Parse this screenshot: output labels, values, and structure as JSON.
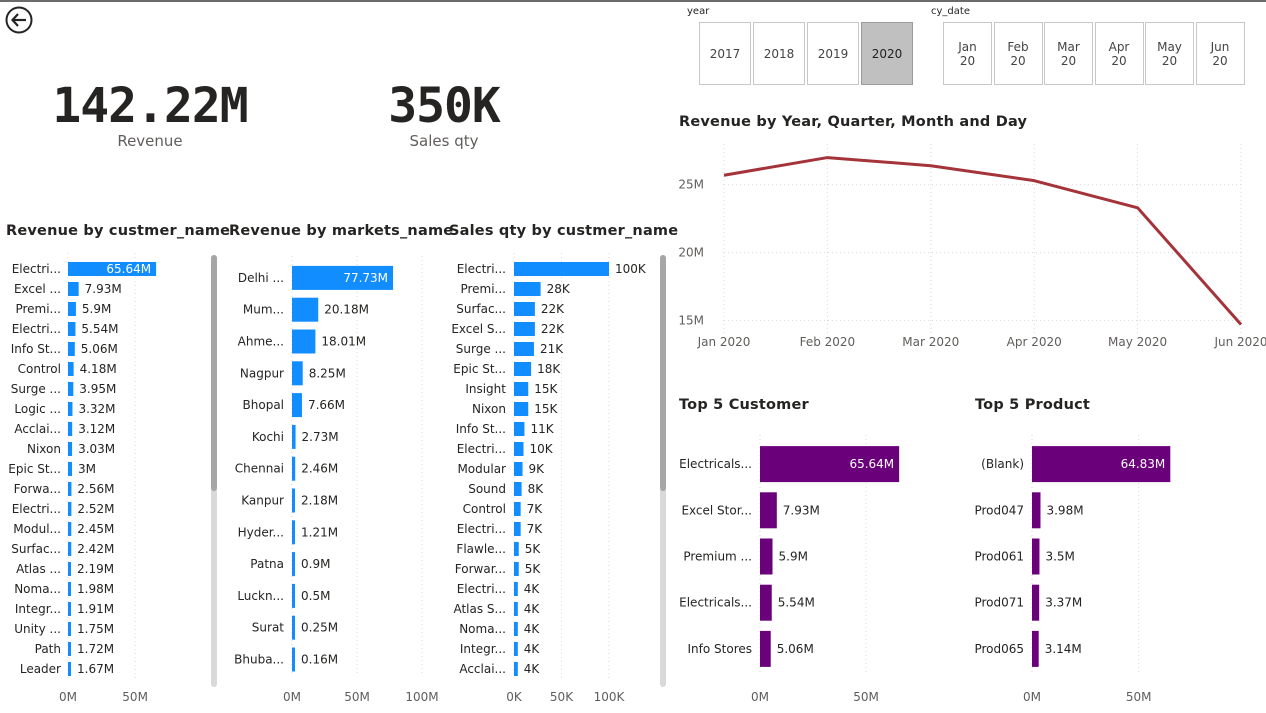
{
  "kpis": {
    "revenue": {
      "value": "142.22M",
      "label": "Revenue"
    },
    "sales_qty": {
      "value": "350K",
      "label": "Sales qty"
    }
  },
  "slicers": {
    "year": {
      "label": "year",
      "options": [
        "2017",
        "2018",
        "2019",
        "2020"
      ],
      "selected": "2020"
    },
    "cy_date": {
      "label": "cy_date",
      "options": [
        {
          "line1": "Jan",
          "line2": "20"
        },
        {
          "line1": "Feb",
          "line2": "20"
        },
        {
          "line1": "Mar",
          "line2": "20"
        },
        {
          "line1": "Apr",
          "line2": "20"
        },
        {
          "line1": "May",
          "line2": "20"
        },
        {
          "line1": "Jun",
          "line2": "20"
        }
      ]
    }
  },
  "colors": {
    "bar_blue": "#118dff",
    "bar_purple": "#6b007b",
    "line_red": "#a4343a",
    "grid": "#d9d9d9",
    "text": "#252423",
    "muted": "#605e5c"
  },
  "icons": {
    "back": "back-arrow-circle-icon"
  },
  "chart_data": [
    {
      "id": "rev_customer",
      "type": "bar",
      "orientation": "horizontal",
      "title": "Revenue by custmer_name",
      "categories": [
        "Electri...",
        "Excel ...",
        "Premi...",
        "Electri...",
        "Info St...",
        "Control",
        "Surge ...",
        "Logic ...",
        "Acclai...",
        "Nixon",
        "Epic St...",
        "Forwa...",
        "Electri...",
        "Modul...",
        "Surfac...",
        "Atlas ...",
        "Noma...",
        "Integr...",
        "Unity ...",
        "Path",
        "Leader"
      ],
      "values": [
        65.64,
        7.93,
        5.9,
        5.54,
        5.06,
        4.18,
        3.95,
        3.32,
        3.12,
        3.03,
        3,
        2.56,
        2.52,
        2.45,
        2.42,
        2.19,
        1.98,
        1.91,
        1.75,
        1.72,
        1.67
      ],
      "data_labels": [
        "65.64M",
        "7.93M",
        "5.9M",
        "5.54M",
        "5.06M",
        "4.18M",
        "3.95M",
        "3.32M",
        "3.12M",
        "3.03M",
        "3M",
        "2.56M",
        "2.52M",
        "2.45M",
        "2.42M",
        "2.19M",
        "1.98M",
        "1.91M",
        "1.75M",
        "1.72M",
        "1.67M"
      ],
      "unit": "M",
      "xlim": [
        0,
        73
      ],
      "xticks": [
        {
          "value": 0,
          "label": "0M"
        },
        {
          "value": 50,
          "label": "50M"
        }
      ],
      "grid": true,
      "scrollbar": true
    },
    {
      "id": "rev_market",
      "type": "bar",
      "orientation": "horizontal",
      "title": "Revenue by markets_name",
      "categories": [
        "Delhi ...",
        "Mum...",
        "Ahme...",
        "Nagpur",
        "Bhopal",
        "Kochi",
        "Chennai",
        "Kanpur",
        "Hyder...",
        "Patna",
        "Luckn...",
        "Surat",
        "Bhuba..."
      ],
      "values": [
        77.73,
        20.18,
        18.01,
        8.25,
        7.66,
        2.73,
        2.46,
        2.18,
        1.21,
        0.9,
        0.5,
        0.25,
        0.16
      ],
      "data_labels": [
        "77.73M",
        "20.18M",
        "18.01M",
        "8.25M",
        "7.66M",
        "2.73M",
        "2.46M",
        "2.18M",
        "1.21M",
        "0.9M",
        "0.5M",
        "0.25M",
        "0.16M"
      ],
      "unit": "M",
      "xlim": [
        0,
        100
      ],
      "xticks": [
        {
          "value": 0,
          "label": "0M"
        },
        {
          "value": 50,
          "label": "50M"
        },
        {
          "value": 100,
          "label": "100M"
        }
      ],
      "grid": true
    },
    {
      "id": "qty_customer",
      "type": "bar",
      "orientation": "horizontal",
      "title": "Sales qty by custmer_name",
      "categories": [
        "Electri...",
        "Premi...",
        "Surfac...",
        "Excel S...",
        "Surge ...",
        "Epic St...",
        "Insight",
        "Nixon",
        "Info St...",
        "Electri...",
        "Modular",
        "Sound",
        "Control",
        "Electri...",
        "Flawle...",
        "Forwar...",
        "Electri...",
        "Atlas S...",
        "Noma...",
        "Integr...",
        "Acclai..."
      ],
      "values": [
        100,
        28,
        22,
        22,
        21,
        18,
        15,
        15,
        11,
        10,
        9,
        8,
        7,
        7,
        5,
        5,
        4,
        4,
        4,
        4,
        4
      ],
      "data_labels": [
        "100K",
        "28K",
        "22K",
        "22K",
        "21K",
        "18K",
        "15K",
        "15K",
        "11K",
        "10K",
        "9K",
        "8K",
        "7K",
        "7K",
        "5K",
        "5K",
        "4K",
        "4K",
        "4K",
        "4K",
        "4K"
      ],
      "unit": "K",
      "xlim": [
        0,
        100
      ],
      "xticks": [
        {
          "value": 0,
          "label": "0K"
        },
        {
          "value": 50,
          "label": "50K"
        },
        {
          "value": 100,
          "label": "100K"
        }
      ],
      "grid": true,
      "scrollbar": true
    },
    {
      "id": "rev_trend",
      "type": "line",
      "title": "Revenue by Year, Quarter, Month and Day",
      "x": [
        "Jan 2020",
        "Feb 2020",
        "Mar 2020",
        "Apr 2020",
        "May 2020",
        "Jun 2020"
      ],
      "values": [
        25.7,
        27.0,
        26.4,
        25.3,
        23.3,
        14.7
      ],
      "unit": "M",
      "ylim": [
        14,
        28
      ],
      "yticks": [
        {
          "value": 15,
          "label": "15M"
        },
        {
          "value": 20,
          "label": "20M"
        },
        {
          "value": 25,
          "label": "25M"
        }
      ],
      "grid": true
    },
    {
      "id": "top_customer",
      "type": "bar",
      "orientation": "horizontal",
      "title": "Top 5 Customer",
      "categories": [
        "Electricals...",
        "Excel Stor...",
        "Premium ...",
        "Electricals...",
        "Info Stores"
      ],
      "values": [
        65.64,
        7.93,
        5.9,
        5.54,
        5.06
      ],
      "data_labels": [
        "65.64M",
        "7.93M",
        "5.9M",
        "5.54M",
        "5.06M"
      ],
      "unit": "M",
      "xlim": [
        0,
        75
      ],
      "xticks": [
        {
          "value": 0,
          "label": "0M"
        },
        {
          "value": 50,
          "label": "50M"
        }
      ],
      "grid": true
    },
    {
      "id": "top_product",
      "type": "bar",
      "orientation": "horizontal",
      "title": "Top 5 Product",
      "categories": [
        "(Blank)",
        "Prod047",
        "Prod061",
        "Prod071",
        "Prod065"
      ],
      "values": [
        64.83,
        3.98,
        3.5,
        3.37,
        3.14
      ],
      "data_labels": [
        "64.83M",
        "3.98M",
        "3.5M",
        "3.37M",
        "3.14M"
      ],
      "unit": "M",
      "xlim": [
        0,
        75
      ],
      "xticks": [
        {
          "value": 0,
          "label": "0M"
        },
        {
          "value": 50,
          "label": "50M"
        }
      ],
      "grid": true
    }
  ]
}
